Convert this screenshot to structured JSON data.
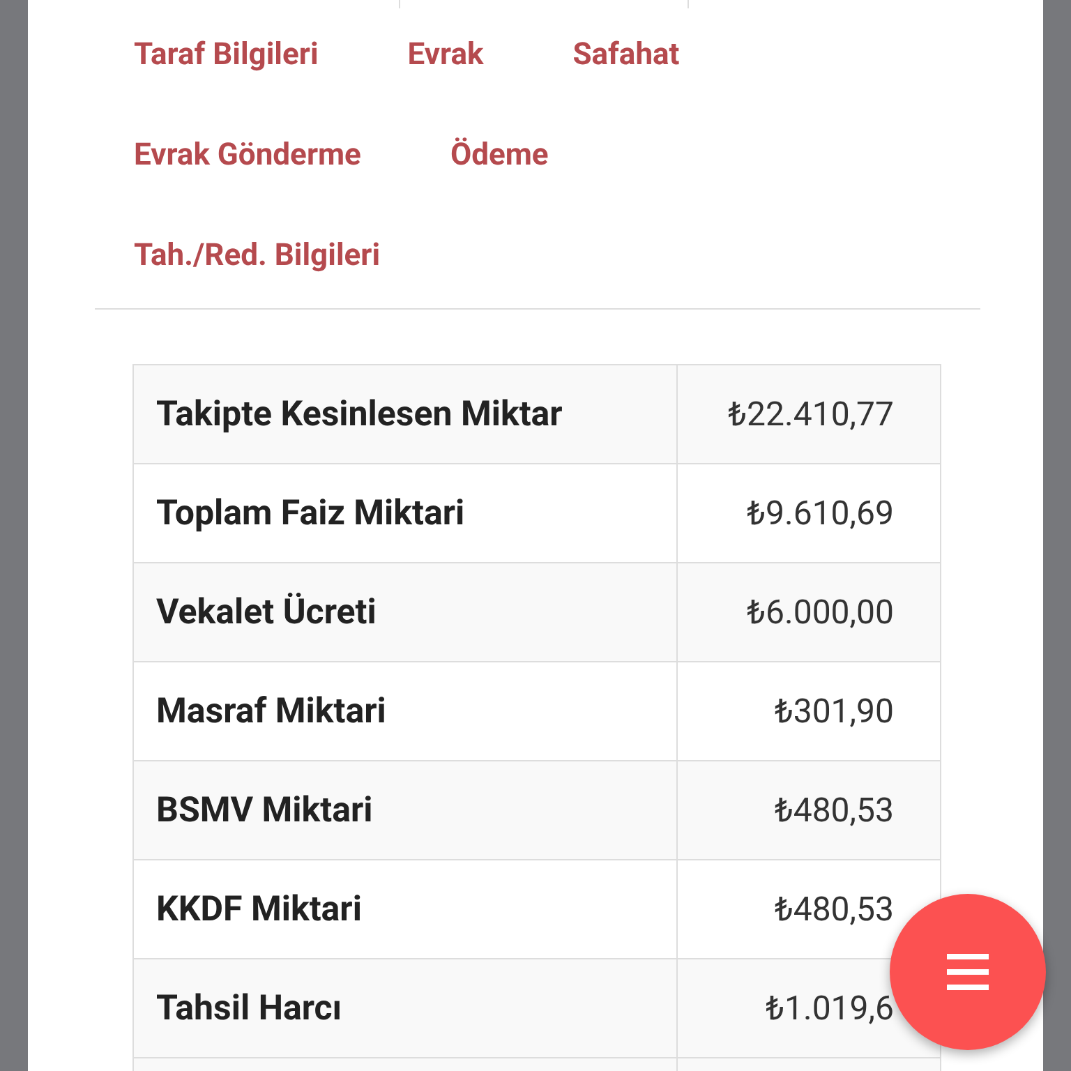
{
  "nav_rows": [
    [
      {
        "label": "Taraf Bilgileri"
      },
      {
        "label": "Evrak"
      },
      {
        "label": "Safahat"
      }
    ],
    [
      {
        "label": "Evrak Gönderme"
      },
      {
        "label": "Ödeme"
      }
    ],
    [
      {
        "label": "Tah./Red. Bilgileri"
      }
    ]
  ],
  "table": {
    "rows": [
      {
        "label": "Takipte Kesinlesen Miktar",
        "value": "₺22.410,77"
      },
      {
        "label": "Toplam Faiz Miktari",
        "value": "₺9.610,69"
      },
      {
        "label": "Vekalet Ücreti",
        "value": "₺6.000,00"
      },
      {
        "label": "Masraf Miktari",
        "value": "₺301,90"
      },
      {
        "label": "BSMV Miktari",
        "value": "₺480,53"
      },
      {
        "label": "KKDF Miktari",
        "value": "₺480,53"
      },
      {
        "label": "Tahsil Harcı",
        "value": "₺1.019,6"
      }
    ]
  }
}
